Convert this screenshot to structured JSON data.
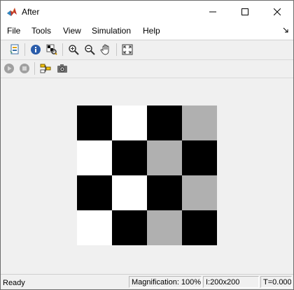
{
  "window": {
    "title": "After"
  },
  "menu": [
    "File",
    "Tools",
    "View",
    "Simulation",
    "Help"
  ],
  "board": {
    "colors": {
      "black": "#000000",
      "white": "#ffffff",
      "gray": "#b0b0b0"
    },
    "grid": [
      [
        "black",
        "white",
        "black",
        "gray"
      ],
      [
        "white",
        "black",
        "gray",
        "black"
      ],
      [
        "black",
        "white",
        "black",
        "gray"
      ],
      [
        "white",
        "black",
        "gray",
        "black"
      ]
    ]
  },
  "status": {
    "state": "Ready",
    "magnification": "Magnification: 100%",
    "image_size": "I:200x200",
    "time": "T=0.000"
  }
}
